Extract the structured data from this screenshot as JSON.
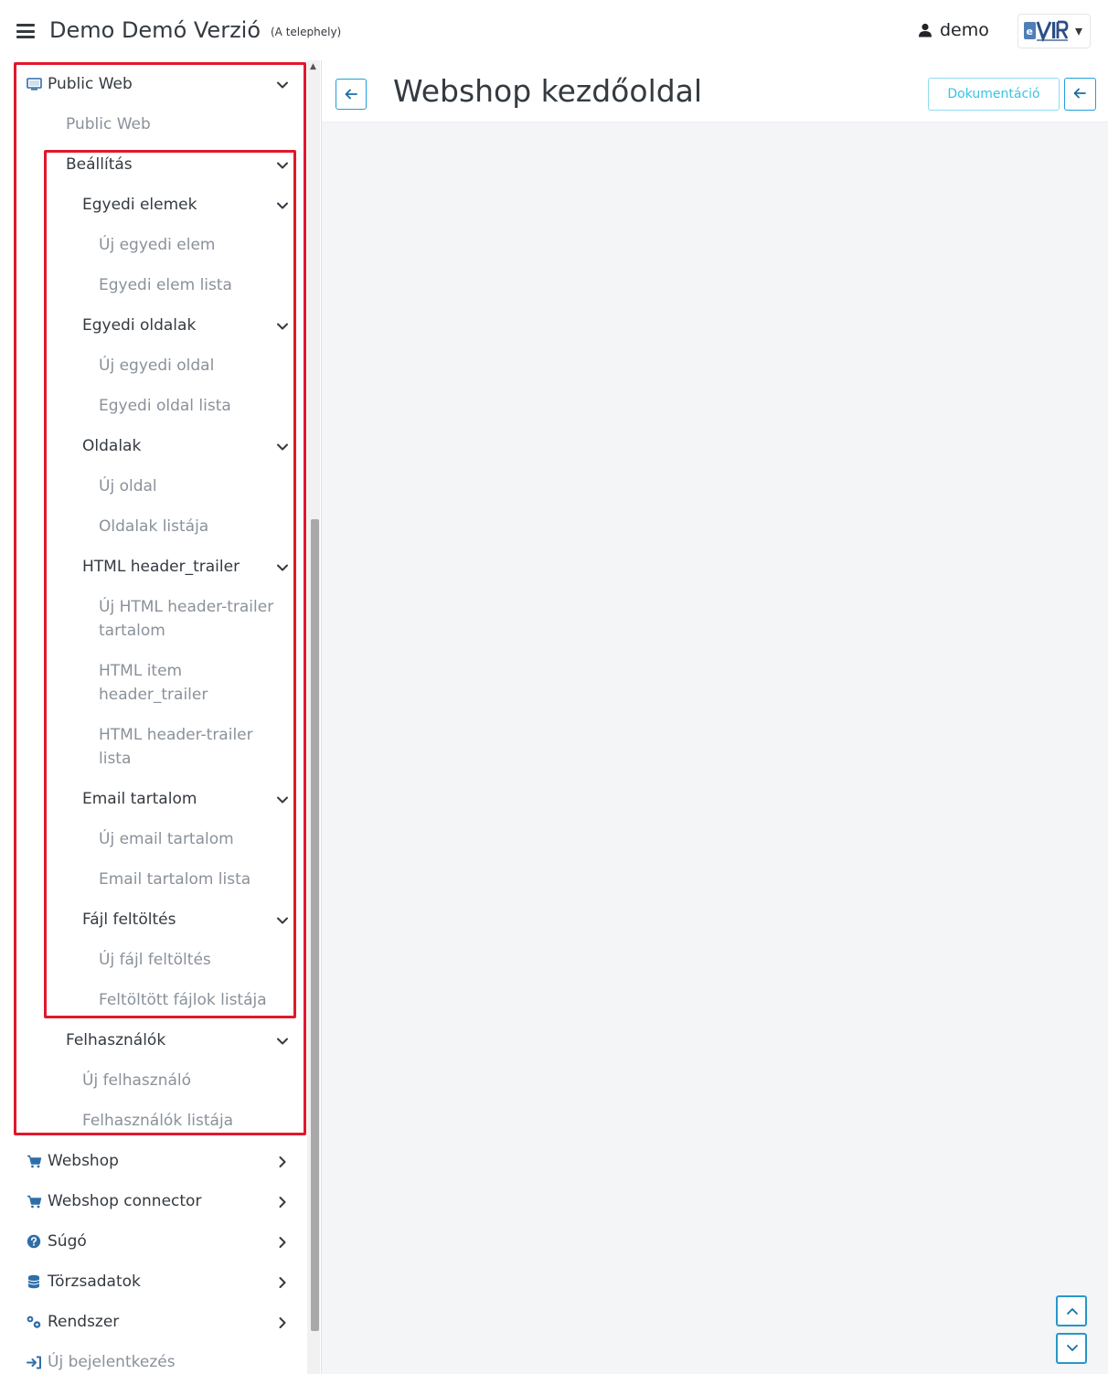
{
  "header": {
    "app_title": "Demo Demó Verzió",
    "site_label": "(A telephely)",
    "user_name": "demo",
    "brand_logo_text": "eVIR"
  },
  "sidebar": {
    "items": [
      {
        "label": "Public Web",
        "level": "top",
        "icon": "desktop-icon",
        "chevron": "down"
      },
      {
        "label": "Public Web",
        "level": "leaf1"
      },
      {
        "label": "Beállítás",
        "level": "sub1",
        "chevron": "down"
      },
      {
        "label": "Egyedi elemek",
        "level": "sub2",
        "chevron": "down"
      },
      {
        "label": "Új egyedi elem",
        "level": "leaf3"
      },
      {
        "label": "Egyedi elem lista",
        "level": "leaf3"
      },
      {
        "label": "Egyedi oldalak",
        "level": "sub2",
        "chevron": "down"
      },
      {
        "label": "Új egyedi oldal",
        "level": "leaf3"
      },
      {
        "label": "Egyedi oldal lista",
        "level": "leaf3"
      },
      {
        "label": "Oldalak",
        "level": "sub2",
        "chevron": "down"
      },
      {
        "label": "Új oldal",
        "level": "leaf3"
      },
      {
        "label": "Oldalak listája",
        "level": "leaf3"
      },
      {
        "label": "HTML header_trailer",
        "level": "sub2",
        "chevron": "down"
      },
      {
        "label": "Új HTML header-trailer",
        "label2": "tartalom",
        "level": "leaf3"
      },
      {
        "label": "HTML item",
        "label2": "header_trailer",
        "level": "leaf3"
      },
      {
        "label": "HTML header-trailer",
        "label2": "lista",
        "level": "leaf3"
      },
      {
        "label": "Email tartalom",
        "level": "sub2",
        "chevron": "down"
      },
      {
        "label": "Új email tartalom",
        "level": "leaf3"
      },
      {
        "label": "Email tartalom lista",
        "level": "leaf3"
      },
      {
        "label": "Fájl feltöltés",
        "level": "sub2",
        "chevron": "down"
      },
      {
        "label": "Új fájl feltöltés",
        "level": "leaf3"
      },
      {
        "label": "Feltöltött fájlok listája",
        "level": "leaf3"
      },
      {
        "label": "Felhasználók",
        "level": "sub1",
        "chevron": "down"
      },
      {
        "label": "Új felhasználó",
        "level": "leaf2"
      },
      {
        "label": "Felhasználók listája",
        "level": "leaf2"
      },
      {
        "label": "Webshop",
        "level": "top",
        "icon": "cart-icon",
        "chevron": "right"
      },
      {
        "label": "Webshop connector",
        "level": "top",
        "icon": "cart-icon",
        "chevron": "right"
      },
      {
        "label": "Súgó",
        "level": "top",
        "icon": "question-circle-icon",
        "chevron": "right"
      },
      {
        "label": "Törzsadatok",
        "level": "top",
        "icon": "database-icon",
        "chevron": "right"
      },
      {
        "label": "Rendszer",
        "level": "top",
        "icon": "cogs-icon",
        "chevron": "right"
      },
      {
        "label": "Új bejelentkezés",
        "level": "top-muted",
        "icon": "sign-in-icon"
      }
    ]
  },
  "main": {
    "page_title": "Webshop kezdőoldal",
    "doc_button": "Dokumentáció"
  },
  "colors": {
    "accent": "#1fa0dc",
    "highlight": "#e1182b",
    "doc_button_text": "#3bc3e3"
  }
}
